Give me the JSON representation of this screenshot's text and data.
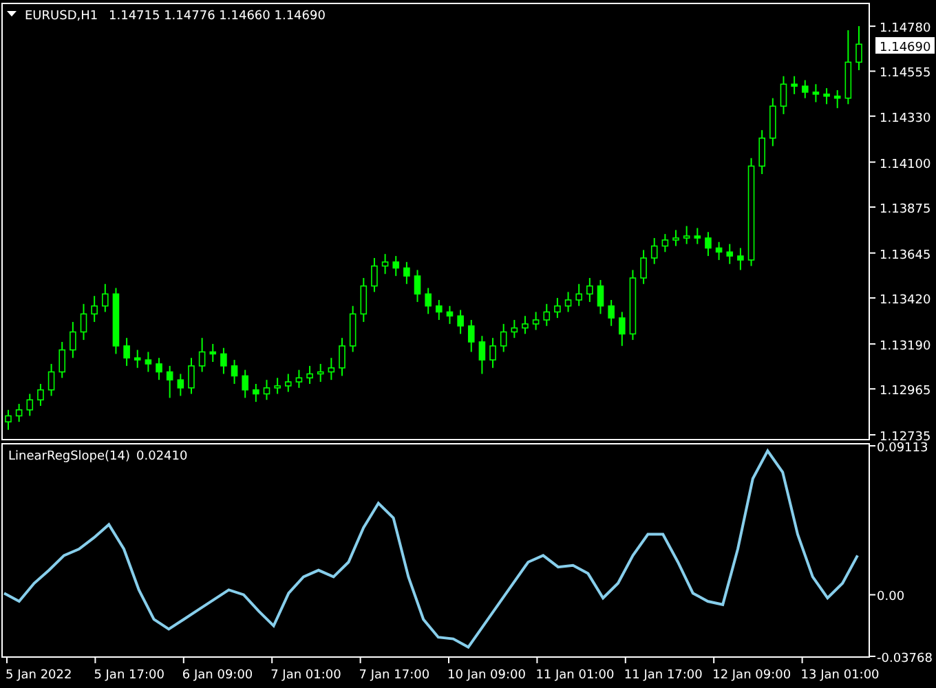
{
  "chart_header": {
    "symbol": "EURUSD,H1",
    "quote": "1.14715 1.14776 1.14660 1.14690"
  },
  "price_chart": {
    "chart_data": {
      "type": "candlestick",
      "ylim": [
        1.12711,
        1.14894
      ],
      "yticks": [
        {
          "value": 1.1478,
          "label": "1.14780"
        },
        {
          "value": 1.14555,
          "label": "1.14555"
        },
        {
          "value": 1.1433,
          "label": "1.14330"
        },
        {
          "value": 1.141,
          "label": "1.14100"
        },
        {
          "value": 1.13875,
          "label": "1.13875"
        },
        {
          "value": 1.13645,
          "label": "1.13645"
        },
        {
          "value": 1.1342,
          "label": "1.13420"
        },
        {
          "value": 1.1319,
          "label": "1.13190"
        },
        {
          "value": 1.12965,
          "label": "1.12965"
        },
        {
          "value": 1.12735,
          "label": "1.12735"
        }
      ],
      "categories": [
        null,
        null,
        null,
        null,
        null,
        null,
        null,
        null,
        null,
        null,
        null,
        null,
        null,
        null,
        null,
        null,
        null,
        null,
        null,
        null,
        null,
        null,
        null,
        null,
        null,
        null,
        null,
        null,
        null,
        null,
        null,
        null,
        null,
        null,
        null,
        null,
        null,
        null,
        null,
        null,
        null,
        null,
        null,
        null,
        null,
        null,
        null,
        null,
        null,
        null,
        null,
        null,
        null,
        null,
        null,
        null,
        null,
        null,
        null,
        null,
        null,
        null,
        null,
        null,
        null,
        null,
        null,
        null,
        null,
        null,
        null,
        null,
        null,
        null,
        null,
        null,
        null,
        null,
        null,
        null
      ],
      "ohlc": [
        [
          1.128,
          1.1286,
          1.1276,
          1.1283
        ],
        [
          1.1283,
          1.1289,
          1.128,
          1.1286
        ],
        [
          1.1286,
          1.1294,
          1.1283,
          1.1291
        ],
        [
          1.1291,
          1.1299,
          1.1288,
          1.1296
        ],
        [
          1.1296,
          1.1309,
          1.1293,
          1.1305
        ],
        [
          1.1305,
          1.132,
          1.1302,
          1.1316
        ],
        [
          1.1316,
          1.133,
          1.1312,
          1.1325
        ],
        [
          1.1325,
          1.1339,
          1.1321,
          1.1334
        ],
        [
          1.1334,
          1.1343,
          1.133,
          1.1338
        ],
        [
          1.1338,
          1.1349,
          1.1335,
          1.1344
        ],
        [
          1.1344,
          1.1347,
          1.1314,
          1.1318
        ],
        [
          1.1318,
          1.1322,
          1.1308,
          1.1312
        ],
        [
          1.1312,
          1.1316,
          1.1307,
          1.1311
        ],
        [
          1.1311,
          1.1315,
          1.1305,
          1.1309
        ],
        [
          1.1309,
          1.1312,
          1.1301,
          1.1305
        ],
        [
          1.1305,
          1.1308,
          1.1292,
          1.1301
        ],
        [
          1.1301,
          1.1304,
          1.1293,
          1.1297
        ],
        [
          1.1297,
          1.1312,
          1.1294,
          1.1308
        ],
        [
          1.1308,
          1.1322,
          1.1305,
          1.1315
        ],
        [
          1.1315,
          1.1319,
          1.131,
          1.1314
        ],
        [
          1.1314,
          1.1317,
          1.1304,
          1.1308
        ],
        [
          1.1308,
          1.1311,
          1.1299,
          1.1303
        ],
        [
          1.1303,
          1.1306,
          1.1292,
          1.1296
        ],
        [
          1.1296,
          1.1299,
          1.129,
          1.1294
        ],
        [
          1.1294,
          1.1301,
          1.1291,
          1.1297
        ],
        [
          1.1297,
          1.1302,
          1.1294,
          1.1298
        ],
        [
          1.1298,
          1.1304,
          1.1295,
          1.13
        ],
        [
          1.13,
          1.1306,
          1.1297,
          1.1302
        ],
        [
          1.1302,
          1.1308,
          1.1299,
          1.1304
        ],
        [
          1.1304,
          1.1309,
          1.13,
          1.1305
        ],
        [
          1.1305,
          1.1312,
          1.1301,
          1.1307
        ],
        [
          1.1307,
          1.1322,
          1.1303,
          1.1318
        ],
        [
          1.1318,
          1.1338,
          1.1315,
          1.1334
        ],
        [
          1.1334,
          1.1352,
          1.133,
          1.1348
        ],
        [
          1.1348,
          1.1362,
          1.1345,
          1.1358
        ],
        [
          1.1358,
          1.1364,
          1.1354,
          1.136
        ],
        [
          1.136,
          1.1363,
          1.1353,
          1.1357
        ],
        [
          1.1357,
          1.136,
          1.1349,
          1.1353
        ],
        [
          1.1353,
          1.1356,
          1.134,
          1.1344
        ],
        [
          1.1344,
          1.1347,
          1.1334,
          1.1338
        ],
        [
          1.1338,
          1.1341,
          1.1331,
          1.1335
        ],
        [
          1.1335,
          1.1338,
          1.1329,
          1.1333
        ],
        [
          1.1333,
          1.1336,
          1.1324,
          1.1328
        ],
        [
          1.1328,
          1.1331,
          1.1315,
          1.132
        ],
        [
          1.132,
          1.1323,
          1.1304,
          1.1311
        ],
        [
          1.1311,
          1.1322,
          1.1307,
          1.1318
        ],
        [
          1.1318,
          1.1329,
          1.1315,
          1.1325
        ],
        [
          1.1325,
          1.1331,
          1.1322,
          1.1327
        ],
        [
          1.1327,
          1.1333,
          1.1324,
          1.1329
        ],
        [
          1.1329,
          1.1335,
          1.1326,
          1.1331
        ],
        [
          1.1331,
          1.1339,
          1.1328,
          1.1335
        ],
        [
          1.1335,
          1.1342,
          1.1332,
          1.1338
        ],
        [
          1.1338,
          1.1345,
          1.1335,
          1.1341
        ],
        [
          1.1341,
          1.1349,
          1.1338,
          1.1344
        ],
        [
          1.1344,
          1.1352,
          1.134,
          1.1348
        ],
        [
          1.1348,
          1.1351,
          1.1334,
          1.1338
        ],
        [
          1.1338,
          1.1341,
          1.1328,
          1.1332
        ],
        [
          1.1332,
          1.1335,
          1.1318,
          1.1324
        ],
        [
          1.1324,
          1.1356,
          1.1321,
          1.1352
        ],
        [
          1.1352,
          1.1366,
          1.1349,
          1.1362
        ],
        [
          1.1362,
          1.1372,
          1.1359,
          1.1368
        ],
        [
          1.1368,
          1.1374,
          1.1365,
          1.1371
        ],
        [
          1.1371,
          1.1376,
          1.1368,
          1.1372
        ],
        [
          1.1372,
          1.1378,
          1.1369,
          1.1373
        ],
        [
          1.1373,
          1.1377,
          1.1369,
          1.1372
        ],
        [
          1.1372,
          1.1375,
          1.1363,
          1.1367
        ],
        [
          1.1367,
          1.137,
          1.1361,
          1.1365
        ],
        [
          1.1365,
          1.1369,
          1.1359,
          1.1363
        ],
        [
          1.1363,
          1.1367,
          1.1356,
          1.1361
        ],
        [
          1.1361,
          1.1412,
          1.1358,
          1.1408
        ],
        [
          1.1408,
          1.1426,
          1.1404,
          1.1422
        ],
        [
          1.1422,
          1.1442,
          1.1418,
          1.1438
        ],
        [
          1.1438,
          1.1453,
          1.1434,
          1.1449
        ],
        [
          1.1449,
          1.1453,
          1.1444,
          1.1448
        ],
        [
          1.1448,
          1.1451,
          1.1442,
          1.1445
        ],
        [
          1.1445,
          1.1449,
          1.144,
          1.1444
        ],
        [
          1.1444,
          1.1447,
          1.1439,
          1.1443
        ],
        [
          1.1443,
          1.1446,
          1.1437,
          1.1442
        ],
        [
          1.1442,
          1.1476,
          1.1439,
          1.146
        ],
        [
          1.146,
          1.1478,
          1.1456,
          1.1469
        ]
      ]
    }
  },
  "price_axis": {
    "current_price": "1.14690"
  },
  "indicator": {
    "value": "0.02410",
    "chart_data": {
      "type": "line",
      "ylim": [
        -0.03768,
        0.09113
      ],
      "yticks": [
        {
          "value": 0.09113,
          "label": "0.09113"
        },
        {
          "value": 0,
          "label": "0.00"
        },
        {
          "value": -0.03768,
          "label": "-0.03768"
        }
      ],
      "series": [
        {
          "name": "LinearRegSlope(14)",
          "color": "#87ceeb",
          "values": [
            0.001,
            -0.004,
            0.007,
            0.015,
            0.024,
            0.028,
            0.035,
            0.043,
            0.028,
            0.003,
            -0.015,
            -0.021,
            -0.015,
            -0.009,
            -0.003,
            0.003,
            0.0,
            -0.01,
            -0.019,
            0.001,
            0.011,
            0.015,
            0.011,
            0.02,
            0.041,
            0.056,
            0.047,
            0.011,
            -0.015,
            -0.026,
            -0.027,
            -0.032,
            -0.019,
            -0.006,
            0.007,
            0.02,
            0.024,
            0.017,
            0.018,
            0.013,
            -0.002,
            0.007,
            0.024,
            0.037,
            0.037,
            0.02,
            0.001,
            -0.004,
            -0.006,
            0.028,
            0.071,
            0.088,
            0.075,
            0.037,
            0.011,
            -0.002,
            0.007,
            0.024
          ]
        }
      ]
    }
  },
  "time_axis": [
    "5 Jan 2022",
    "5 Jan 17:00",
    "6 Jan 09:00",
    "7 Jan 01:00",
    "7 Jan 17:00",
    "10 Jan 09:00",
    "11 Jan 01:00",
    "11 Jan 17:00",
    "12 Jan 09:00",
    "13 Jan 01:00"
  ]
}
